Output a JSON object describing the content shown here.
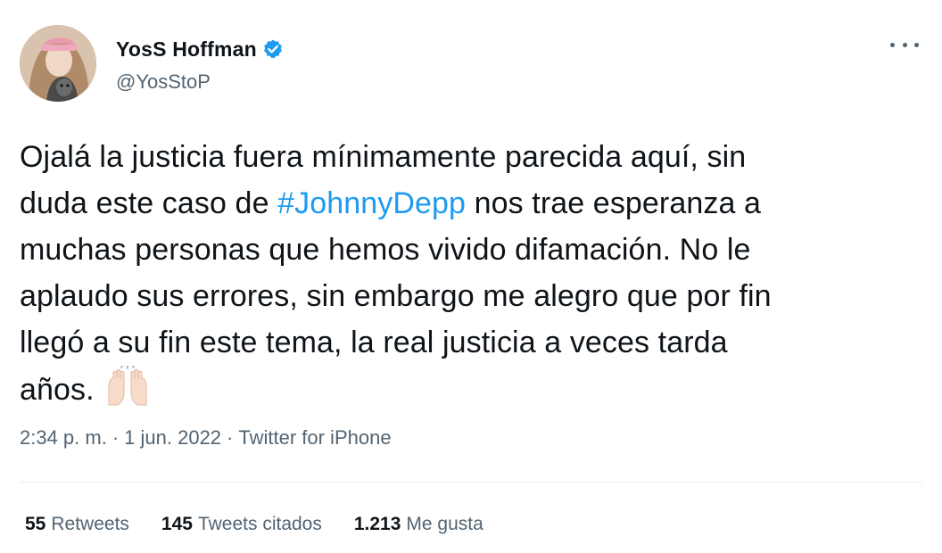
{
  "author": {
    "display_name": "YosS Hoffman",
    "handle": "@YosStoP",
    "verified": true
  },
  "tweet": {
    "lines": [
      {
        "before": "Ojalá la justicia fuera mínimamente parecida aquí, sin"
      },
      {
        "before": "duda este caso de ",
        "hashtag": "#JohnnyDepp",
        "after": " nos trae esperanza a"
      },
      {
        "before": "muchas personas que hemos vivido difamación. No le"
      },
      {
        "before": "aplaudo sus errores, sin embargo me alegro que por fin"
      },
      {
        "before": "llegó a su fin este tema, la real justicia a veces tarda"
      },
      {
        "before": "años."
      }
    ],
    "emoji": "raising-hands-icon"
  },
  "meta": {
    "time": "2:34 p. m.",
    "separator": "·",
    "date": "1 jun. 2022",
    "source": "Twitter for iPhone"
  },
  "stats": [
    {
      "count": "55",
      "label": "Retweets"
    },
    {
      "count": "145",
      "label": "Tweets citados"
    },
    {
      "count": "1.213",
      "label": "Me gusta"
    }
  ],
  "colors": {
    "accent": "#1d9bf0",
    "text": "#0f1419",
    "secondary": "#536471"
  }
}
